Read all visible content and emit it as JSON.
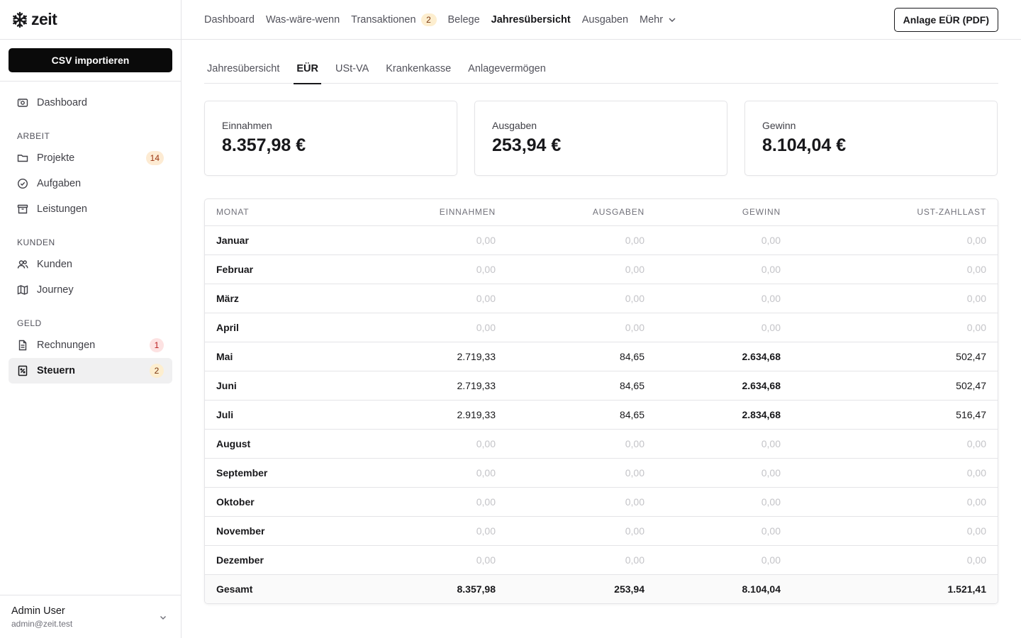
{
  "app": {
    "name": "zeit"
  },
  "sidebar": {
    "import_label": "CSV importieren",
    "dashboard": "Dashboard",
    "sections": [
      {
        "label": "ARBEIT",
        "items": [
          {
            "label": "Projekte",
            "icon": "folder-icon",
            "badge": "14"
          },
          {
            "label": "Aufgaben",
            "icon": "check-circle-icon",
            "badge": ""
          },
          {
            "label": "Leistungen",
            "icon": "archive-icon",
            "badge": ""
          }
        ]
      },
      {
        "label": "KUNDEN",
        "items": [
          {
            "label": "Kunden",
            "icon": "users-icon",
            "badge": ""
          },
          {
            "label": "Journey",
            "icon": "map-icon",
            "badge": ""
          }
        ]
      },
      {
        "label": "GELD",
        "items": [
          {
            "label": "Rechnungen",
            "icon": "file-icon",
            "badge": "1"
          },
          {
            "label": "Steuern",
            "icon": "tax-receipt-icon",
            "badge": "2"
          }
        ]
      }
    ],
    "user": {
      "name": "Admin User",
      "email": "admin@zeit.test"
    }
  },
  "topbar": {
    "items": [
      "Dashboard",
      "Was-wäre-wenn",
      "Transaktionen",
      "Belege",
      "Jahresübersicht",
      "Ausgaben",
      "Mehr"
    ],
    "transaktionen_badge": "2",
    "active": "Jahresübersicht",
    "pdf_button": "Anlage EÜR (PDF)"
  },
  "tabs": {
    "items": [
      "Jahresübersicht",
      "EÜR",
      "USt-VA",
      "Krankenkasse",
      "Anlagevermögen"
    ],
    "active": "EÜR"
  },
  "summary": {
    "income_label": "Einnahmen",
    "income_value": "8.357,98 €",
    "expenses_label": "Ausgaben",
    "expenses_value": "253,94 €",
    "profit_label": "Gewinn",
    "profit_value": "8.104,04 €"
  },
  "table": {
    "headers": [
      "MONAT",
      "EINNAHMEN",
      "AUSGABEN",
      "GEWINN",
      "UST-ZAHLLAST"
    ],
    "rows": [
      [
        "Januar",
        "0,00",
        "0,00",
        "0,00",
        "0,00"
      ],
      [
        "Februar",
        "0,00",
        "0,00",
        "0,00",
        "0,00"
      ],
      [
        "März",
        "0,00",
        "0,00",
        "0,00",
        "0,00"
      ],
      [
        "April",
        "0,00",
        "0,00",
        "0,00",
        "0,00"
      ],
      [
        "Mai",
        "2.719,33",
        "84,65",
        "2.634,68",
        "502,47"
      ],
      [
        "Juni",
        "2.719,33",
        "84,65",
        "2.634,68",
        "502,47"
      ],
      [
        "Juli",
        "2.919,33",
        "84,65",
        "2.834,68",
        "516,47"
      ],
      [
        "August",
        "0,00",
        "0,00",
        "0,00",
        "0,00"
      ],
      [
        "September",
        "0,00",
        "0,00",
        "0,00",
        "0,00"
      ],
      [
        "Oktober",
        "0,00",
        "0,00",
        "0,00",
        "0,00"
      ],
      [
        "November",
        "0,00",
        "0,00",
        "0,00",
        "0,00"
      ],
      [
        "Dezember",
        "0,00",
        "0,00",
        "0,00",
        "0,00"
      ]
    ],
    "total": [
      "Gesamt",
      "8.357,98",
      "253,94",
      "8.104,04",
      "1.521,41"
    ]
  }
}
